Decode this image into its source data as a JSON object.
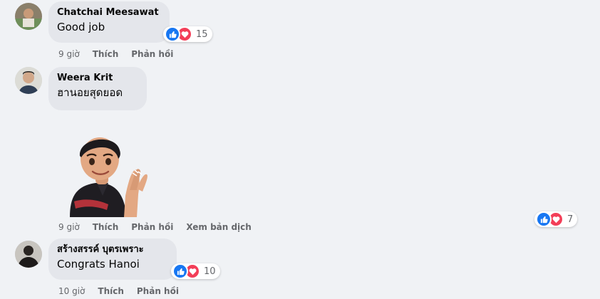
{
  "comments": [
    {
      "author": "Chatchai Meesawat",
      "text": "Good job",
      "reaction_count": "15",
      "time": "9 giờ",
      "actions": [
        "Thích",
        "Phản hồi"
      ]
    },
    {
      "author": "Weera Krit",
      "text": "ฮานอยสุดยอด",
      "sticker": "avatar-clapping-sticker",
      "reaction_count": "7",
      "time": "9 giờ",
      "actions": [
        "Thích",
        "Phản hồi",
        "Xem bản dịch"
      ]
    },
    {
      "author": "สร้างสรรค์ บุตรเพราะ",
      "text": "Congrats Hanoi",
      "reaction_count": "10",
      "time": "10 giờ",
      "actions": [
        "Thích",
        "Phản hồi"
      ]
    }
  ],
  "icons": {
    "like": "thumbs-up-icon",
    "love": "heart-icon"
  },
  "colors": {
    "background": "#f0f2f5",
    "bubble": "#e4e6eb",
    "like_blue": "#1877f2",
    "love_red": "#f33e58",
    "meta_gray": "#65676b"
  }
}
